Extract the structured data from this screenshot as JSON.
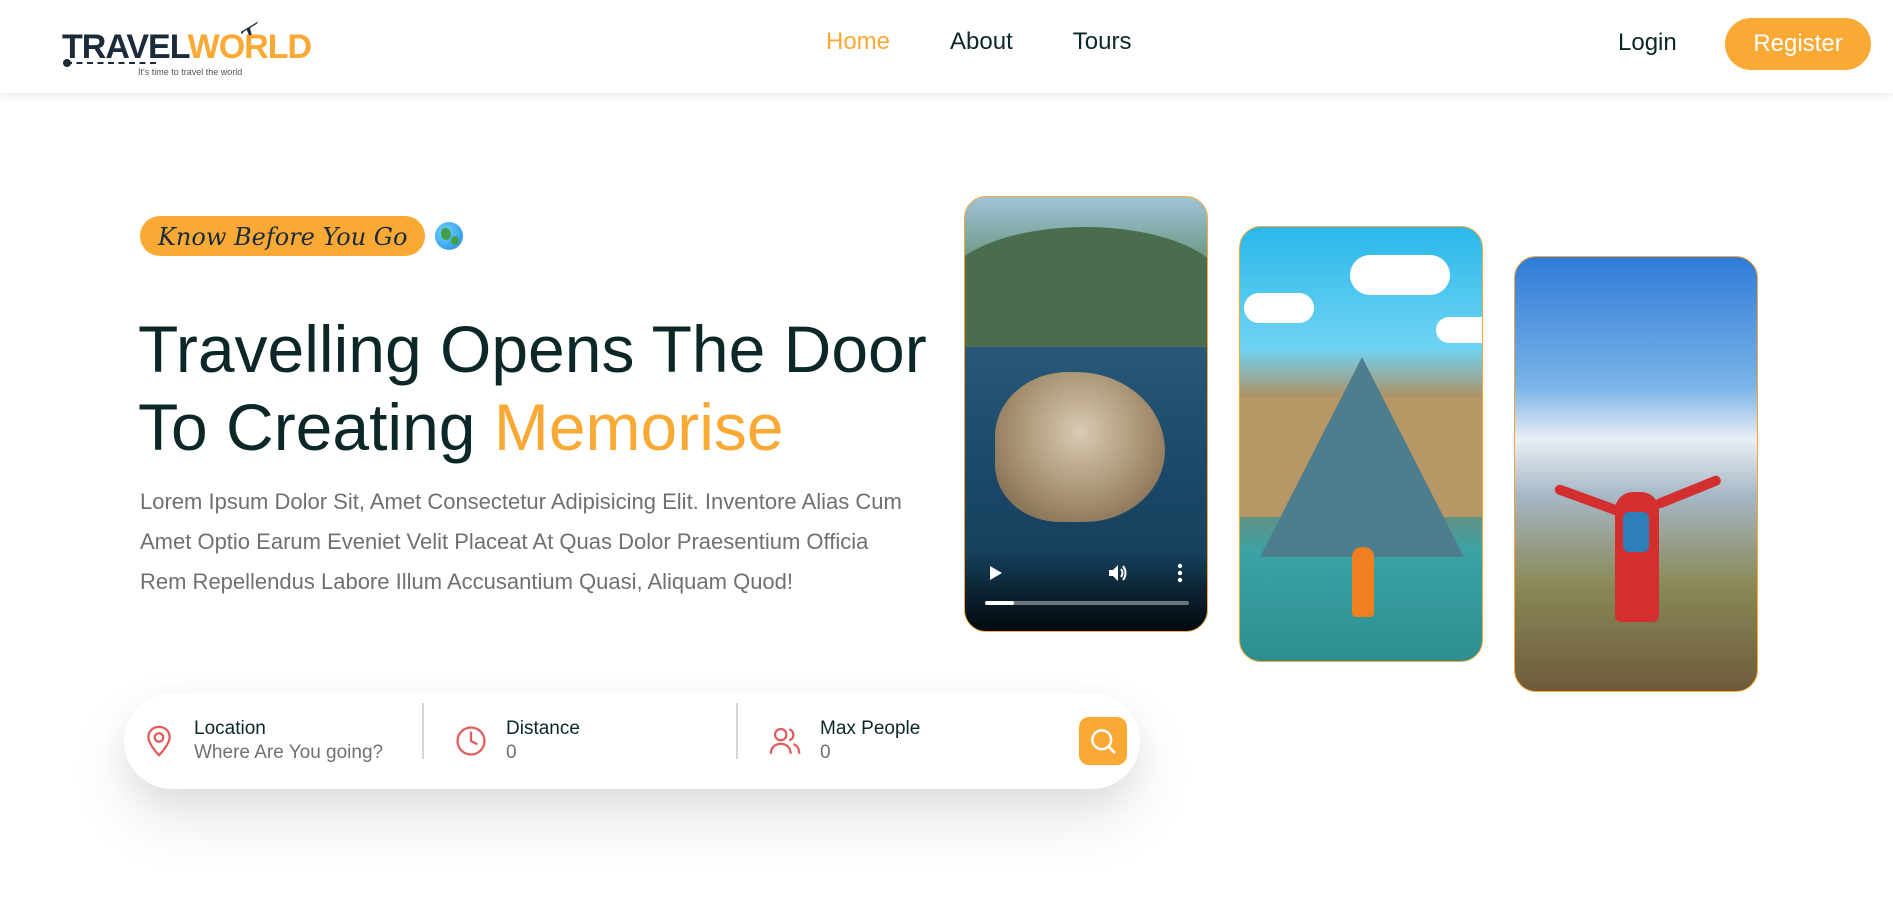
{
  "header": {
    "logo": {
      "brand_part1": "TRAVEL",
      "brand_part2": "WORLD",
      "tagline": "It's time to travel the world"
    },
    "nav": [
      {
        "label": "Home",
        "active": true
      },
      {
        "label": "About",
        "active": false
      },
      {
        "label": "Tours",
        "active": false
      }
    ],
    "login_label": "Login",
    "register_label": "Register"
  },
  "hero": {
    "subtitle": "Know Before You Go",
    "title_part1": "Travelling Opens The Door To Creating ",
    "title_highlight": "Memorise",
    "description": "Lorem Ipsum Dolor Sit, Amet Consectetur Adipisicing Elit. Inventore Alias Cum Amet Optio Earum Eveniet Velit Placeat At Quas Dolor Praesentium Officia Rem Repellendus Labore Illum Accusantium Quasi, Aliquam Quod!",
    "video_progress": 0.14
  },
  "search": {
    "location": {
      "label": "Location",
      "placeholder": "Where Are You going?"
    },
    "distance": {
      "label": "Distance",
      "value": "0"
    },
    "max_people": {
      "label": "Max People",
      "value": "0"
    }
  },
  "colors": {
    "accent": "#faa935",
    "heading": "#0b2727",
    "text_muted": "#6e7074",
    "icon": "#e35b5b"
  }
}
